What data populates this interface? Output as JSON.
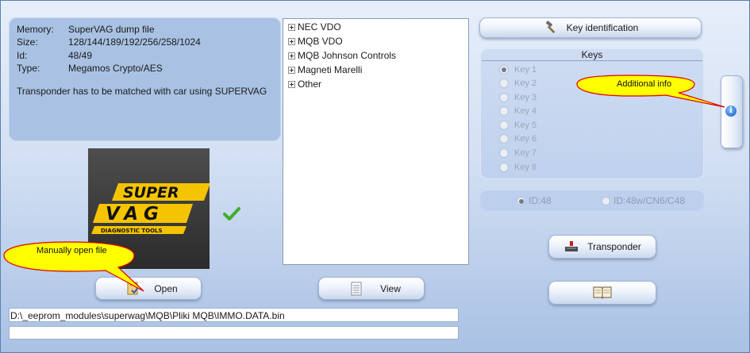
{
  "info": {
    "rows": [
      {
        "label": "Memory:",
        "value": "SuperVAG dump file"
      },
      {
        "label": "Size:",
        "value": "128/144/189/192/256/258/1024"
      },
      {
        "label": "Id:",
        "value": "48/49"
      },
      {
        "label": "Type:",
        "value": "Megamos Crypto/AES"
      }
    ],
    "note": "Transponder has to be matched with car using SUPERVAG"
  },
  "tree": {
    "items": [
      "NEC VDO",
      "MQB VDO",
      "MQB Johnson Controls",
      "Magneti Marelli",
      "Other"
    ]
  },
  "buttons": {
    "key_identification": "Key identification",
    "transponder": "Transponder",
    "open": "Open",
    "view": "View"
  },
  "keys": {
    "title": "Keys",
    "items": [
      "Key 1",
      "Key 2",
      "Key 3",
      "Key 4",
      "Key 5",
      "Key 6",
      "Key 7",
      "Key 8"
    ],
    "selected": "Key 1"
  },
  "id_options": {
    "option1": "ID:48",
    "option2": "ID:48w/CN6/C48",
    "selected": "ID:48"
  },
  "logo": {
    "line1": "SUPER",
    "line2": "VAG",
    "tagline": "DIAGNOSTIC TOOLS"
  },
  "balloons": {
    "additional_info": "Additional info",
    "manually_open": "Manually open file"
  },
  "path": "D:\\_eeprom_modules\\superwag\\MQB\\Pliki MQB\\IMMO.DATA.bin",
  "status": "",
  "colors": {
    "balloon_fill": "#ffff00",
    "balloon_border": "#e00000",
    "check": "#3fae2a",
    "logo_yellow": "#f5c400"
  },
  "icons": {
    "key_identification": "hammer-icon",
    "transponder": "transponder-icon",
    "open": "open-file-icon",
    "view": "document-icon",
    "book": "book-icon",
    "info": "info-icon",
    "status": "checkmark-icon"
  }
}
